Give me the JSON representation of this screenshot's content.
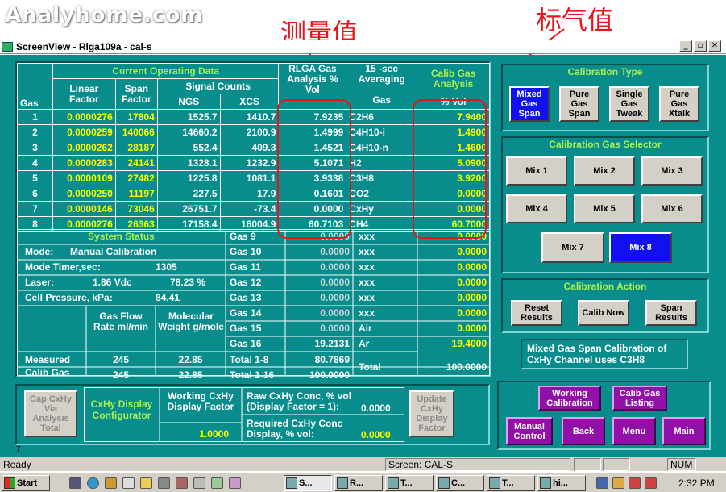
{
  "watermark": "Analyhome.com",
  "annotations": {
    "measured": "测量值",
    "standard": "标气值"
  },
  "window": {
    "title": "ScreenView - Rlga109a - cal-s",
    "min": "_",
    "restore": "▫",
    "close": "✕"
  },
  "table": {
    "hdr_current": "Current Operating Data",
    "hdr_gas": "Gas",
    "hdr_linear": "Linear Factor",
    "hdr_span": "Span Factor",
    "hdr_signal": "Signal Counts",
    "hdr_ngs": "NGS",
    "hdr_xcs": "XCS",
    "hdr_rlga": "RLGA Gas Analysis % Vol",
    "hdr_avg_num": "15",
    "hdr_avg": "-sec Averaging",
    "hdr_gas2": "Gas",
    "hdr_calib": "Calib Gas Analysis",
    "hdr_pvol": "% Vol",
    "rows": [
      {
        "n": "1",
        "lin": "0.0000276",
        "span": "17804",
        "ngs": "1525.7",
        "xcs": "1410.7",
        "rlga": "7.9235",
        "gas": "C2H6",
        "cal": "7.9400"
      },
      {
        "n": "2",
        "lin": "0.0000259",
        "span": "140066",
        "ngs": "14660.2",
        "xcs": "2100.9",
        "rlga": "1.4999",
        "gas": "C4H10-i",
        "cal": "1.4900"
      },
      {
        "n": "3",
        "lin": "0.0000262",
        "span": "28187",
        "ngs": "552.4",
        "xcs": "409.3",
        "rlga": "1.4521",
        "gas": "C4H10-n",
        "cal": "1.4600"
      },
      {
        "n": "4",
        "lin": "0.0000283",
        "span": "24141",
        "ngs": "1328.1",
        "xcs": "1232.9",
        "rlga": "5.1071",
        "gas": "H2",
        "cal": "5.0900"
      },
      {
        "n": "5",
        "lin": "0.0000109",
        "span": "27482",
        "ngs": "1225.8",
        "xcs": "1081.1",
        "rlga": "3.9338",
        "gas": "C3H8",
        "cal": "3.9200"
      },
      {
        "n": "6",
        "lin": "0.0000250",
        "span": "11197",
        "ngs": "227.5",
        "xcs": "17.9",
        "rlga": "0.1601",
        "gas": "CO2",
        "cal": "0.0000"
      },
      {
        "n": "7",
        "lin": "0.0000146",
        "span": "73046",
        "ngs": "26751.7",
        "xcs": "-73.4",
        "rlga": "0.0000",
        "gas": "CxHy",
        "cal": "0.0000"
      },
      {
        "n": "8",
        "lin": "0.0000276",
        "span": "26363",
        "ngs": "17158.4",
        "xcs": "16004.9",
        "rlga": "60.7103",
        "gas": "CH4",
        "cal": "60.7000"
      }
    ],
    "status_hdr": "System Status",
    "mode_l": "Mode:",
    "mode_v": "Manual Calibration",
    "timer_l": "Mode Timer,sec:",
    "timer_v": "1305",
    "laser_l": "Laser:",
    "laser_v": "1.86 Vdc",
    "laser_p": "78.23 %",
    "cell_l": "Cell Pressure, kPa:",
    "cell_v": "84.41",
    "flow_l": "Gas Flow Rate ml/min",
    "mw_l": "Molecular Weight g/mole",
    "meas_l": "Measured",
    "meas_flow": "245",
    "meas_mw": "22.85",
    "calgas_l": "Calib Gas",
    "cal_flow": "245",
    "cal_mw": "22.85",
    "extra": [
      {
        "l": "Gas 9",
        "v": "0.0000",
        "g": "xxx",
        "c": "0.0000"
      },
      {
        "l": "Gas 10",
        "v": "0.0000",
        "g": "xxx",
        "c": "0.0000"
      },
      {
        "l": "Gas 11",
        "v": "0.0000",
        "g": "xxx",
        "c": "0.0000"
      },
      {
        "l": "Gas 12",
        "v": "0.0000",
        "g": "xxx",
        "c": "0.0000"
      },
      {
        "l": "Gas 13",
        "v": "0.0000",
        "g": "xxx",
        "c": "0.0000"
      },
      {
        "l": "Gas 14",
        "v": "0.0000",
        "g": "xxx",
        "c": "0.0000"
      },
      {
        "l": "Gas 15",
        "v": "0.0000",
        "g": "Air",
        "c": "0.0000"
      },
      {
        "l": "Gas 16",
        "v": "19.2131",
        "g": "Ar",
        "c": "19.4000"
      }
    ],
    "total18_l": "Total 1-8",
    "total18_v": "80.7869",
    "total116_l": "Total 1-16",
    "total116_v": "100.0000",
    "total_l": "Total",
    "total_v": "100.0000"
  },
  "cal_type": {
    "title": "Calibration Type",
    "b1": "Mixed Gas Span",
    "b2": "Pure Gas Span",
    "b3": "Single Gas Tweak",
    "b4": "Pure Gas Xtalk"
  },
  "cal_sel": {
    "title": "Calibration Gas Selector",
    "mixes": [
      "Mix 1",
      "Mix 2",
      "Mix 3",
      "Mix 4",
      "Mix 5",
      "Mix 6",
      "Mix 7",
      "Mix 8"
    ]
  },
  "cal_act": {
    "title": "Calibration Action",
    "reset": "Reset Results",
    "calib": "Calib Now",
    "span": "Span Results",
    "note": "Mixed Gas Span Calibration of CxHy Channel uses  C3H8"
  },
  "bottom": {
    "cap": "Cap CxHy Via Analysis Total",
    "cfg": "CxHy Display Configurator",
    "wk_l": "Working CxHy Display Factor",
    "wk_v": "1.0000",
    "raw_l": "Raw CxHy Conc, % vol (Display Factor = 1):",
    "raw_v": "0.0000",
    "req_l": "Required CxHy Conc Display,  % vol:",
    "req_v": "0.0000",
    "upd": "Update CxHy Display Factor",
    "seven": "7"
  },
  "nav": {
    "wcal": "Working Calibration",
    "clist": "Calib Gas Listing",
    "manual": "Manual Control",
    "back": "Back",
    "menu": "Menu",
    "main": "Main"
  },
  "status": {
    "ready": "Ready",
    "screen": "Screen: CAL-S",
    "num": "NUM"
  },
  "taskbar": {
    "start": "Start",
    "tasks": [
      "S...",
      "R...",
      "T...",
      "C...",
      "T...",
      "hi..."
    ],
    "clock": "2:32 PM"
  },
  "colors": {
    "teal": "#088c8c",
    "yellow": "#ffff00",
    "green": "#a8f050",
    "red": "#e8141a",
    "blue": "#1010f0",
    "magenta": "#9010a8"
  }
}
